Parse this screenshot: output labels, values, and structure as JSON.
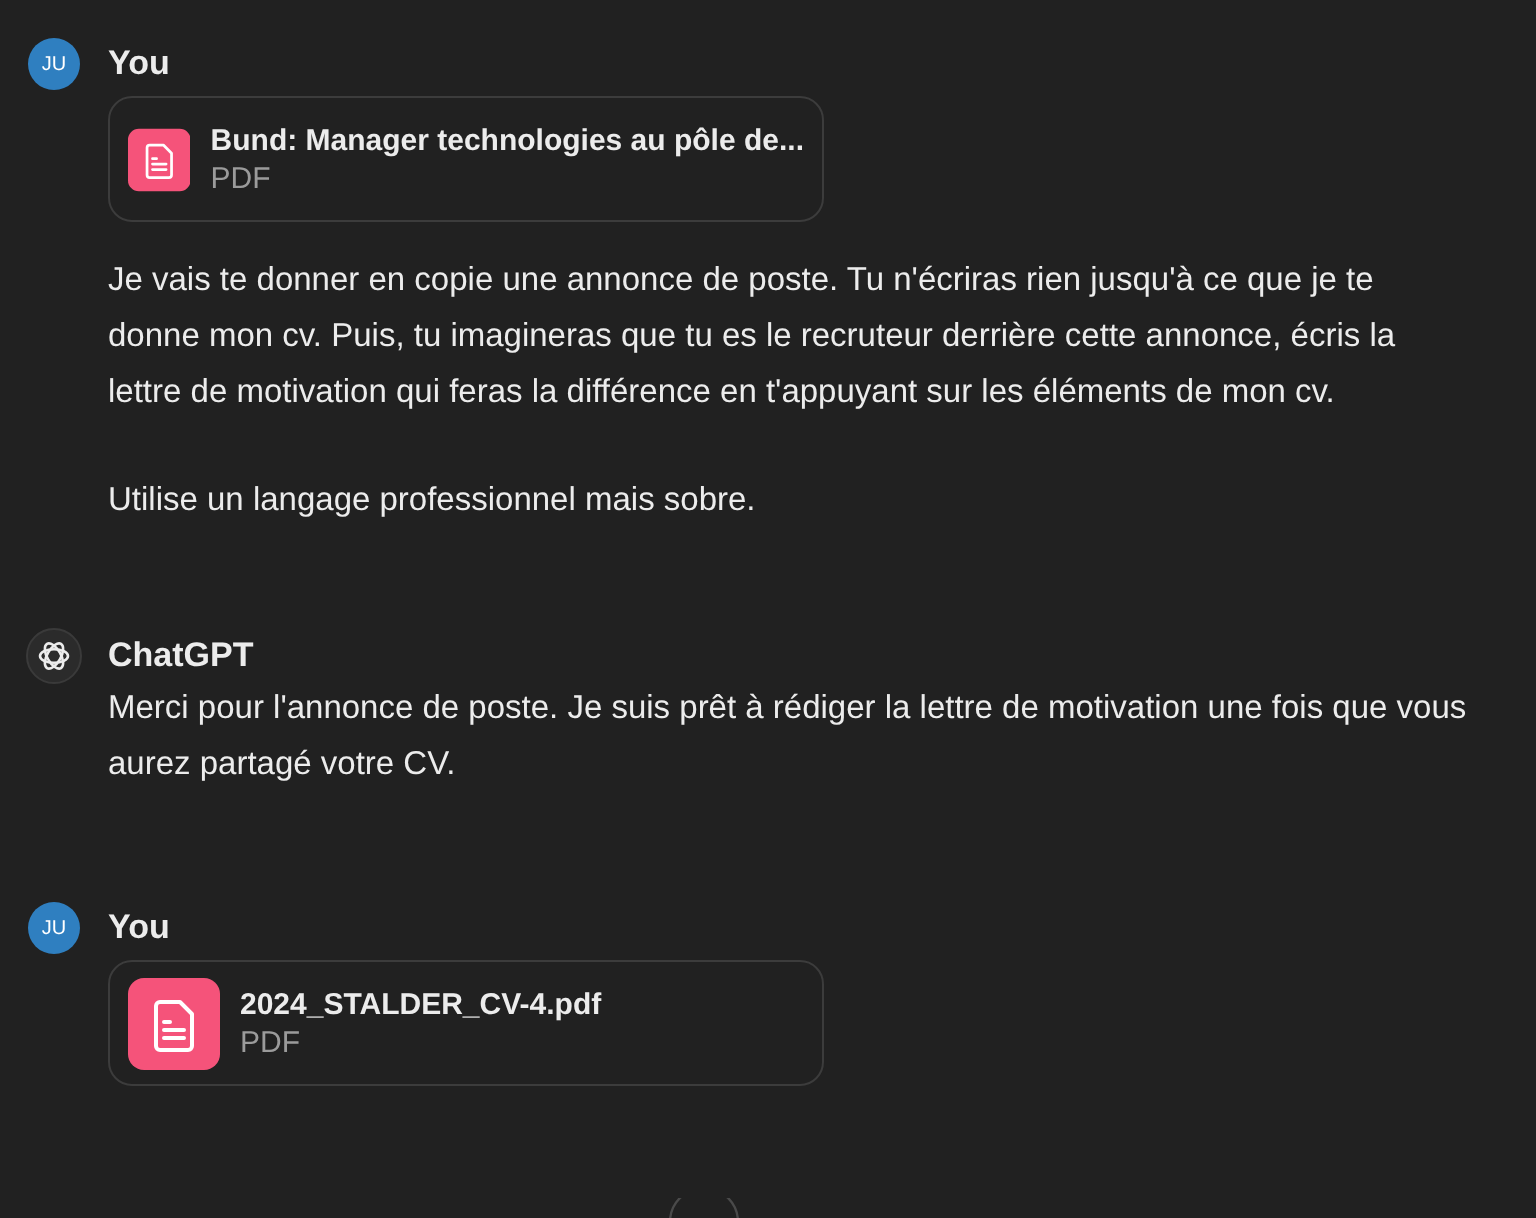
{
  "messages": [
    {
      "kind": "user",
      "author": "You",
      "initials": "JU",
      "attachments": [
        {
          "name": "Bund: Manager technologies au pôle de...",
          "type": "PDF"
        }
      ],
      "paragraphs": [
        "Je vais te donner en copie une annonce de poste. Tu n'écriras rien jusqu'à ce que je te donne mon cv. Puis, tu imagineras que tu es le recruteur derrière cette annonce, écris la lettre de motivation qui feras la différence en t'appuyant sur les éléments de mon cv.",
        "Utilise un langage professionnel mais sobre."
      ]
    },
    {
      "kind": "assistant",
      "author": "ChatGPT",
      "paragraphs": [
        "Merci pour l'annonce de poste. Je suis prêt à rédiger la lettre de motivation une fois que vous aurez partagé votre CV."
      ]
    },
    {
      "kind": "user",
      "author": "You",
      "initials": "JU",
      "attachments": [
        {
          "name": "2024_STALDER_CV-4.pdf",
          "type": "PDF"
        }
      ]
    }
  ]
}
